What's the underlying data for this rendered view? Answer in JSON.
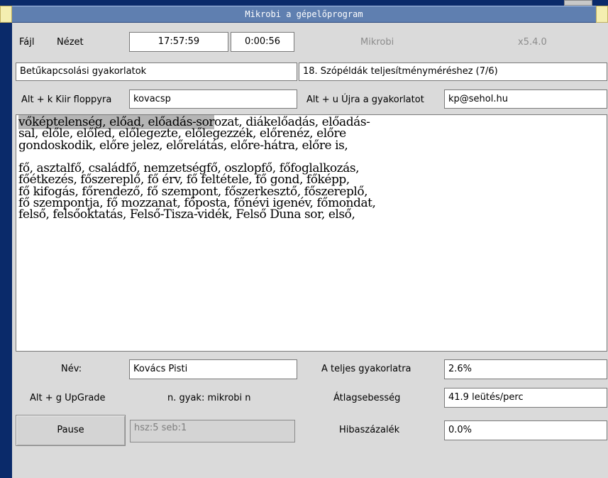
{
  "titlebar": {
    "title": "Mikrobi a gépelőprogram"
  },
  "menu": {
    "file": "Fájl",
    "view": "Nézet"
  },
  "clock": {
    "time": "17:57:59",
    "elapsed": "0:00:56"
  },
  "app": {
    "name": "Mikrobi",
    "version": "x5.4.0"
  },
  "lesson": {
    "group": "Betűkapcsolási gyakorlatok",
    "exercise": "18. Szópéldák teljesítményméréshez (7/6)"
  },
  "save": {
    "label": "Alt + k Kiir floppyra",
    "value": "kovacsp"
  },
  "restart": {
    "label": "Alt + u Újra a gyakorlatot",
    "value": "kp@sehol.hu"
  },
  "text": {
    "typed": "vőképtelenség, előad, előadás-sor",
    "rest_first": "ozat, diákelőadás, előadás-",
    "lines": [
      "sal, előle, előled, előlegezte, előlegezzék, előrenéz, előre",
      "gondoskodik, előre jelez, előrelátás, előre-hátra, előre is,",
      "",
      "fő, asztalfő, családfő, nemzetségfő, oszlopfő, főfoglalkozás,",
      "főétkezés, főszereplő, fő érv, fő feltétele, fő gond, főképp,",
      "fő kifogás, főrendező, fő szempont, főszerkesztő, főszereplő,",
      "fő szempontja, fő mozzanat, főposta, főnévi igenév, főmondat,",
      "felső, felsőoktatás, Felső-Tisza-vidék, Felső Duna sor, első,"
    ]
  },
  "name": {
    "label": "Név:",
    "value": "Kovács Pisti"
  },
  "upgrade": {
    "label": "Alt + g UpGrade",
    "info": "n. gyak: mikrobi n"
  },
  "status": {
    "value": "hsz:5 seb:1"
  },
  "pause": {
    "label": "Pause"
  },
  "stats": {
    "total_label": "A teljes gyakorlatra",
    "total_value": "2.6%",
    "speed_label": "Átlagsebesség",
    "speed_value": "41.9 leütés/perc",
    "error_label": "Hibaszázalék",
    "error_value": "0.0%"
  },
  "colors": {
    "titlebar": "#5f7fb0",
    "desktop": "#0a2a6a",
    "window": "#dadada",
    "highlight": "#b4b4b4"
  }
}
